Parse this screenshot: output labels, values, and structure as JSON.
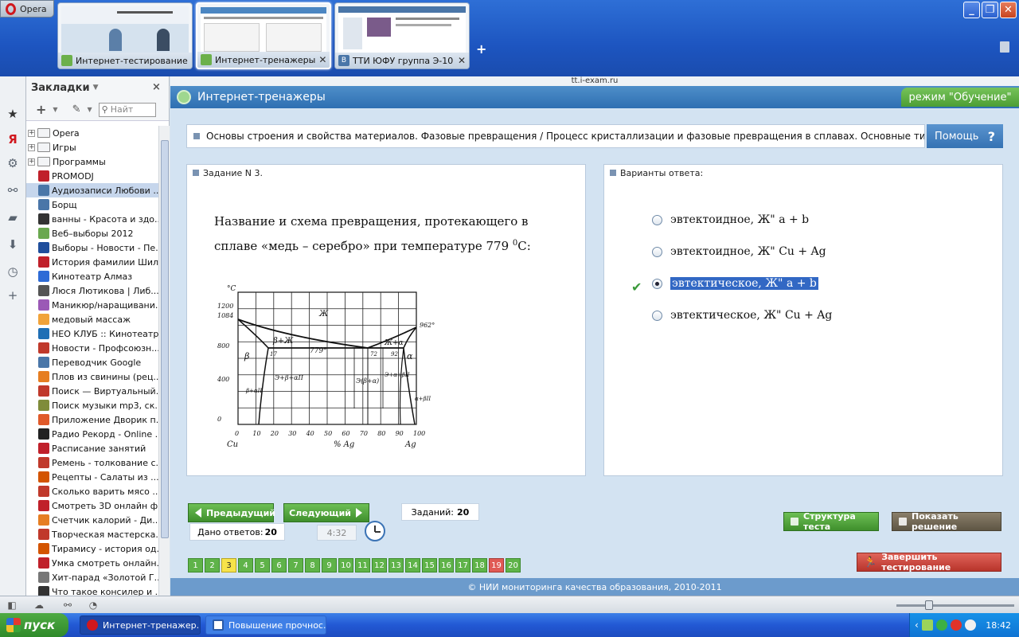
{
  "browser": {
    "menu_label": "Opera",
    "address": "tt.i-exam.ru",
    "tabs": [
      {
        "label": "Интернет-тестирование",
        "active": false
      },
      {
        "label": "Интернет-тренажеры",
        "active": true
      },
      {
        "label": "ТТИ ЮФУ группа Э-10",
        "active": false
      }
    ],
    "new_tab": "+",
    "window_buttons": [
      "_",
      "❐",
      "✕"
    ]
  },
  "bookmarks": {
    "title": "Закладки",
    "close": "×",
    "search_placeholder": "Найт",
    "items": [
      {
        "label": "Opera",
        "kind": "folder"
      },
      {
        "label": "Игры",
        "kind": "folder"
      },
      {
        "label": "Программы",
        "kind": "folder"
      },
      {
        "label": "PROMODJ",
        "kind": "link",
        "color": "#c0202a"
      },
      {
        "label": "Аудиозаписи Любови ...",
        "kind": "link",
        "color": "#4a76a8",
        "selected": true
      },
      {
        "label": "Борщ",
        "kind": "link",
        "color": "#4a76a8"
      },
      {
        "label": "ванны - Красота и здо...",
        "kind": "link",
        "color": "#333333"
      },
      {
        "label": "Веб–выборы 2012",
        "kind": "link",
        "color": "#6aa84f"
      },
      {
        "label": "Выборы - Новости - Пе...",
        "kind": "link",
        "color": "#1f4e9c"
      },
      {
        "label": "История фамилии Шил...",
        "kind": "link",
        "color": "#c0202a"
      },
      {
        "label": "Кинотеатр Алмаз",
        "kind": "link",
        "color": "#2e6bd6"
      },
      {
        "label": "Люся Лютикова | Либ...",
        "kind": "link",
        "color": "#555555"
      },
      {
        "label": "Маникюр/наращивани...",
        "kind": "link",
        "color": "#9b59b6"
      },
      {
        "label": "медовый массаж",
        "kind": "link",
        "color": "#f1a33a"
      },
      {
        "label": "НЕО КЛУБ :: Кинотеатр",
        "kind": "link",
        "color": "#1f6fb5"
      },
      {
        "label": "Новости - Профсоюзн...",
        "kind": "link",
        "color": "#c0392b"
      },
      {
        "label": "Переводчик Google",
        "kind": "link",
        "color": "#4a76a8"
      },
      {
        "label": "Плов из свинины (рец...",
        "kind": "link",
        "color": "#e67e22"
      },
      {
        "label": "Поиск — Виртуальный...",
        "kind": "link",
        "color": "#c0392b"
      },
      {
        "label": "Поиск музыки mp3, ск...",
        "kind": "link",
        "color": "#7f8c3a"
      },
      {
        "label": "Приложение Дворик п...",
        "kind": "link",
        "color": "#e05a2a"
      },
      {
        "label": "Радио Рекорд - Online ...",
        "kind": "link",
        "color": "#222222"
      },
      {
        "label": "Расписание занятий",
        "kind": "link",
        "color": "#c0202a"
      },
      {
        "label": "Ремень - толкование с...",
        "kind": "link",
        "color": "#c0392b"
      },
      {
        "label": "Рецепты - Салаты из ...",
        "kind": "link",
        "color": "#d35400"
      },
      {
        "label": "Сколько варить мясо ...",
        "kind": "link",
        "color": "#c0392b"
      },
      {
        "label": "Смотреть 3D онлайн ф...",
        "kind": "link",
        "color": "#c0202a"
      },
      {
        "label": "Счетчик калорий - Ди...",
        "kind": "link",
        "color": "#e67e22"
      },
      {
        "label": "Творческая мастерска...",
        "kind": "link",
        "color": "#c0392b"
      },
      {
        "label": "Тирамису - история од...",
        "kind": "link",
        "color": "#d35400"
      },
      {
        "label": "Умка смотреть онлайн...",
        "kind": "link",
        "color": "#c0202a"
      },
      {
        "label": "Хит-парад «Золотой Г...",
        "kind": "link",
        "color": "#777777"
      },
      {
        "label": "Что такое консилер и ...",
        "kind": "link",
        "color": "#333333"
      }
    ]
  },
  "app": {
    "title": "Интернет-тренажеры",
    "mode": "режим \"Обучение\"",
    "topic": "Основы строения и свойства материалов. Фазовые превращения / Процесс кристаллизации и фазовые превращения в сплавах. Основные типы диаграмм ...",
    "help": "Помощь",
    "help_icon": "?",
    "task_header": "Задание N 3.",
    "question_main": "Название и схема превращения, протекающего в сплаве «медь – серебро» при температуре 779 ",
    "question_sup": "0",
    "question_end": "С:",
    "answers_header": "Варианты ответа:",
    "answers": [
      {
        "label": "эвтектоидное, Ж\" a + b",
        "selected": false
      },
      {
        "label": "эвтектоидное, Ж\" Cu + Ag",
        "selected": false
      },
      {
        "label": "эвтектическое, Ж\" a + b",
        "selected": true
      },
      {
        "label": "эвтектическое, Ж\" Cu + Ag",
        "selected": false
      }
    ],
    "diagram": {
      "t_axis": "°C",
      "t_ticks": [
        "1200",
        "1084",
        "800",
        "400",
        "0"
      ],
      "x_ticks": [
        "0",
        "10",
        "20",
        "30",
        "40",
        "50",
        "60",
        "70",
        "80",
        "90",
        "100"
      ],
      "x_left": "Cu",
      "x_right": "Ag",
      "x_label": "% Ag",
      "labels": {
        "liquid": "Ж",
        "beta_liquid": "β+Ж",
        "eutectic_t": "779°",
        "liquid_alpha": "Ж+α",
        "beta": "β",
        "alpha": "α",
        "c17": "17",
        "c72": "72",
        "c92": "92",
        "t962": "962°",
        "mix": "Э+β+αII",
        "mid": "Э(β+α)",
        "right": "Э+α+βII",
        "left_low": "β+αII",
        "right_low": "α+βII"
      }
    },
    "prev": "Предыдущий",
    "next": "Следующий",
    "tasks_label": "Заданий:",
    "tasks_total": "20",
    "answered_label": "Дано ответов:",
    "answered_count": "20",
    "timer": "4:32",
    "structure": "Структура теста",
    "show_solution": "Показать решение",
    "finish": "Завершить тестирование",
    "pages": [
      "1",
      "2",
      "3",
      "4",
      "5",
      "6",
      "7",
      "8",
      "9",
      "10",
      "11",
      "12",
      "13",
      "14",
      "15",
      "16",
      "17",
      "18",
      "19",
      "20"
    ],
    "current_page": "3",
    "red_page": "19",
    "footer": "© НИИ мониторинга качества образования, 2010-2011"
  },
  "taskbar": {
    "start": "пуск",
    "buttons": [
      {
        "label": "Интернет-тренажер...",
        "active": true
      },
      {
        "label": "Повышение прочнос...",
        "active": false
      }
    ],
    "time": "18:42"
  }
}
